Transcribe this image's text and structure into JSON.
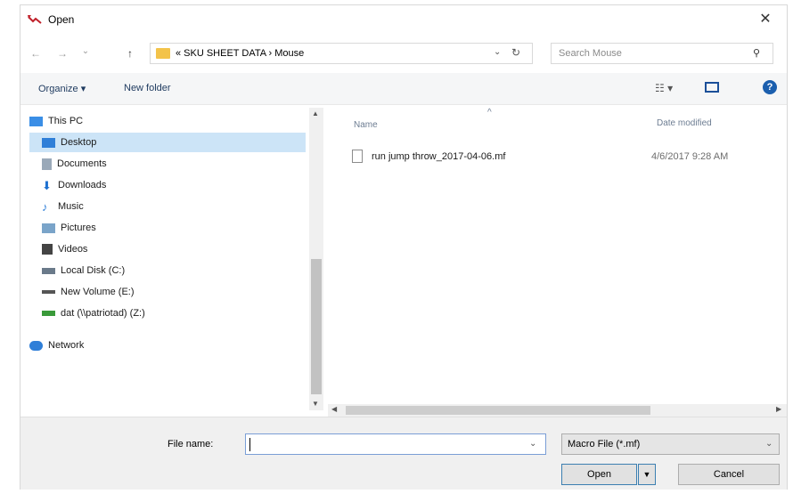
{
  "window": {
    "title": "Open",
    "close_glyph": "✕",
    "accent_icon": "open-arrow-icon",
    "accent_color": "#c0202a"
  },
  "nav": {
    "back_glyph": "←",
    "forward_glyph": "→",
    "recent_glyph": "⌄",
    "up_glyph": "↑",
    "address": {
      "overflow": "«",
      "path": [
        "SKU SHEET DATA",
        "Mouse"
      ],
      "separator": "›",
      "text": "«  SKU SHEET DATA  ›  Mouse",
      "dropdown_glyph": "⌄",
      "refresh_glyph": "↻"
    },
    "search": {
      "placeholder": "Search Mouse",
      "icon": "search-icon",
      "icon_glyph": "⚲"
    }
  },
  "toolbar": {
    "organize": "Organize ▾",
    "new_folder": "New folder",
    "view_glyph": "☷ ▾",
    "help_glyph": "?"
  },
  "nav_pane": {
    "items": [
      {
        "label": "This PC",
        "icon": "computer-icon",
        "color": "#3a8ee6"
      },
      {
        "label": "Desktop",
        "icon": "desktop-icon",
        "color": "#2f7fd8",
        "selected": true
      },
      {
        "label": "Documents",
        "icon": "documents-icon",
        "color": "#9aa9b9"
      },
      {
        "label": "Downloads",
        "icon": "downloads-icon",
        "color": "#1d70d0"
      },
      {
        "label": "Music",
        "icon": "music-icon",
        "color": "#2f7fd8"
      },
      {
        "label": "Pictures",
        "icon": "pictures-icon",
        "color": "#7aa4c9"
      },
      {
        "label": "Videos",
        "icon": "videos-icon",
        "color": "#444444"
      },
      {
        "label": "Local Disk (C:)",
        "icon": "local-disk-icon",
        "color": "#6a7a8a"
      },
      {
        "label": "New Volume (E:)",
        "icon": "drive-icon",
        "color": "#555555"
      },
      {
        "label": "dat (\\\\patriotad) (Z:)",
        "icon": "network-drive-icon",
        "color": "#3a9a3a"
      },
      {
        "label": "Network",
        "icon": "network-icon",
        "color": "#2f7fd8"
      }
    ],
    "scroll_up_glyph": "▲",
    "scroll_down_glyph": "▼"
  },
  "file_pane": {
    "columns": {
      "name": "Name",
      "date": "Date modified"
    },
    "sort_glyph": "^",
    "files": [
      {
        "name": "run jump throw_2017-04-06.mf",
        "date": "4/6/2017 9:28 AM",
        "icon": "file-icon"
      }
    ],
    "hscroll_left_glyph": "◀",
    "hscroll_right_glyph": "▶"
  },
  "footer": {
    "file_name_label": "File name:",
    "file_name_value": "",
    "dropdown_glyph": "⌄",
    "filter": "Macro File (*.mf)",
    "open_label": "Open",
    "open_split_glyph": "▼",
    "cancel_label": "Cancel"
  }
}
